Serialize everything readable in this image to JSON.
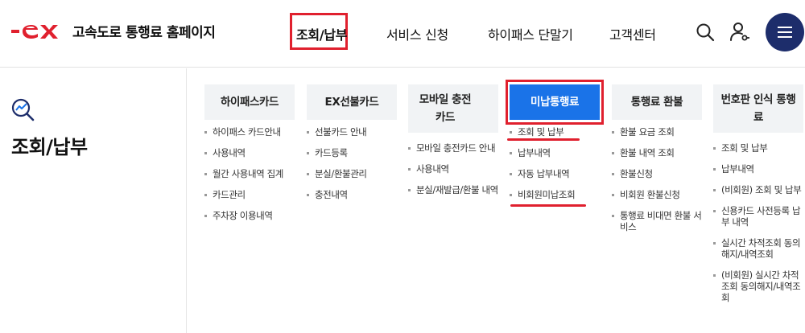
{
  "header": {
    "logo_text": "고속도로 통행료 홈페이지",
    "nav": [
      "조회/납부",
      "서비스 신청",
      "하이패스 단말기",
      "고객센터"
    ]
  },
  "page": {
    "title": "조회/납부"
  },
  "columns": [
    {
      "title": "하이패스카드",
      "items": [
        "하이패스 카드안내",
        "사용내역",
        "월간 사용내역 집계",
        "카드관리",
        "주차장 이용내역"
      ]
    },
    {
      "title": "EX선불카드",
      "items": [
        "선불카드 안내",
        "카드등록",
        "분실/환불관리",
        "충전내역"
      ]
    },
    {
      "title": "모바일 충전카드",
      "items": [
        "모바일 충전카드 안내",
        "사용내역",
        "분실/재발급/환불 내역"
      ]
    },
    {
      "title": "미납통행료",
      "items": [
        "조회 및 납부",
        "납부내역",
        "자동 납부내역",
        "비회원미납조회"
      ]
    },
    {
      "title": "통행료 환불",
      "items": [
        "환불 요금 조회",
        "환불 내역 조회",
        "환불신청",
        "비회원 환불신청",
        "통행료 비대면 환불 서비스"
      ]
    },
    {
      "title": "번호판 인식 통행료",
      "items": [
        "조회 및 납부",
        "납부내역",
        "(비회원) 조회 및 납부",
        "신용카드 사전등록 납부 내역",
        "실시간 차적조회 동의해지/내역조회",
        "(비회원) 실시간 차적조회 동의해지/내역조회"
      ]
    }
  ],
  "icons": {
    "search": "search-icon",
    "user": "user-icon",
    "menu": "hamburger-menu-icon",
    "page": "magnifier-chart-icon"
  },
  "colors": {
    "brand_red": "#e0202e",
    "navy": "#1d2d6b",
    "active_blue": "#1a73e8"
  }
}
